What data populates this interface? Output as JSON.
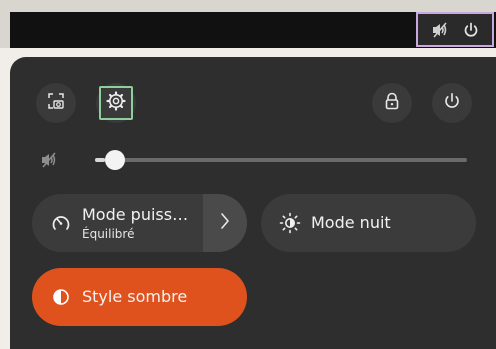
{
  "topbar": {
    "tray_icons": [
      "volume-muted-icon",
      "power-icon"
    ]
  },
  "quick_settings": {
    "top_buttons": [
      {
        "name": "screenshot",
        "icon": "screenshot-icon"
      },
      {
        "name": "settings",
        "icon": "gear-icon"
      },
      {
        "name": "lock",
        "icon": "lock-icon"
      },
      {
        "name": "power",
        "icon": "power-icon"
      }
    ],
    "volume": {
      "icon": "volume-muted-icon",
      "level": 0
    },
    "power_mode": {
      "title": "Mode puiss…",
      "subtitle": "Équilibré",
      "icon": "power-mode-icon",
      "arrow_icon": "chevron-right-icon"
    },
    "night_mode": {
      "title": "Mode nuit",
      "icon": "night-light-icon"
    },
    "dark_style": {
      "title": "Style sombre",
      "icon": "dark-style-icon",
      "active": true
    }
  },
  "colors": {
    "accent": "#e0521d",
    "panel_bg": "#2e2e2e",
    "button_bg": "#3b3b3b",
    "highlight_tray": "#c9a8e0",
    "highlight_settings": "#8ecf9d"
  }
}
